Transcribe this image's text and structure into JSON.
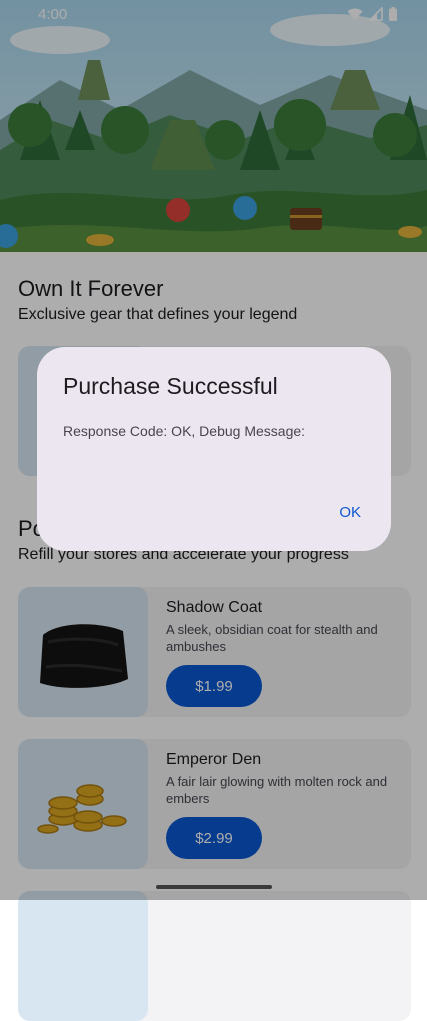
{
  "status_bar": {
    "time": "4:00"
  },
  "store": {
    "own_forever": {
      "title": "Own It Forever",
      "subtitle": "Exclusive gear that defines your legend"
    },
    "power_ups": {
      "title": "Po",
      "subtitle": "Refill your stores and accelerate your progress"
    },
    "items": [
      {
        "name": "Shadow Coat",
        "description": "A sleek, obsidian coat for stealth and ambushes",
        "price": "$1.99",
        "image_icon": "black-coat"
      },
      {
        "name": "Emperor Den",
        "description": "A fair lair glowing with molten rock and embers",
        "price": "$2.99",
        "image_icon": "gold-coins"
      }
    ]
  },
  "dialog": {
    "title": "Purchase Successful",
    "message": "Response Code: OK, Debug Message:",
    "ok_label": "OK"
  },
  "colors": {
    "accent": "#0b57d0",
    "dialog_bg": "#ece6f0",
    "scrim": "rgba(0,0,0,0.32)"
  }
}
